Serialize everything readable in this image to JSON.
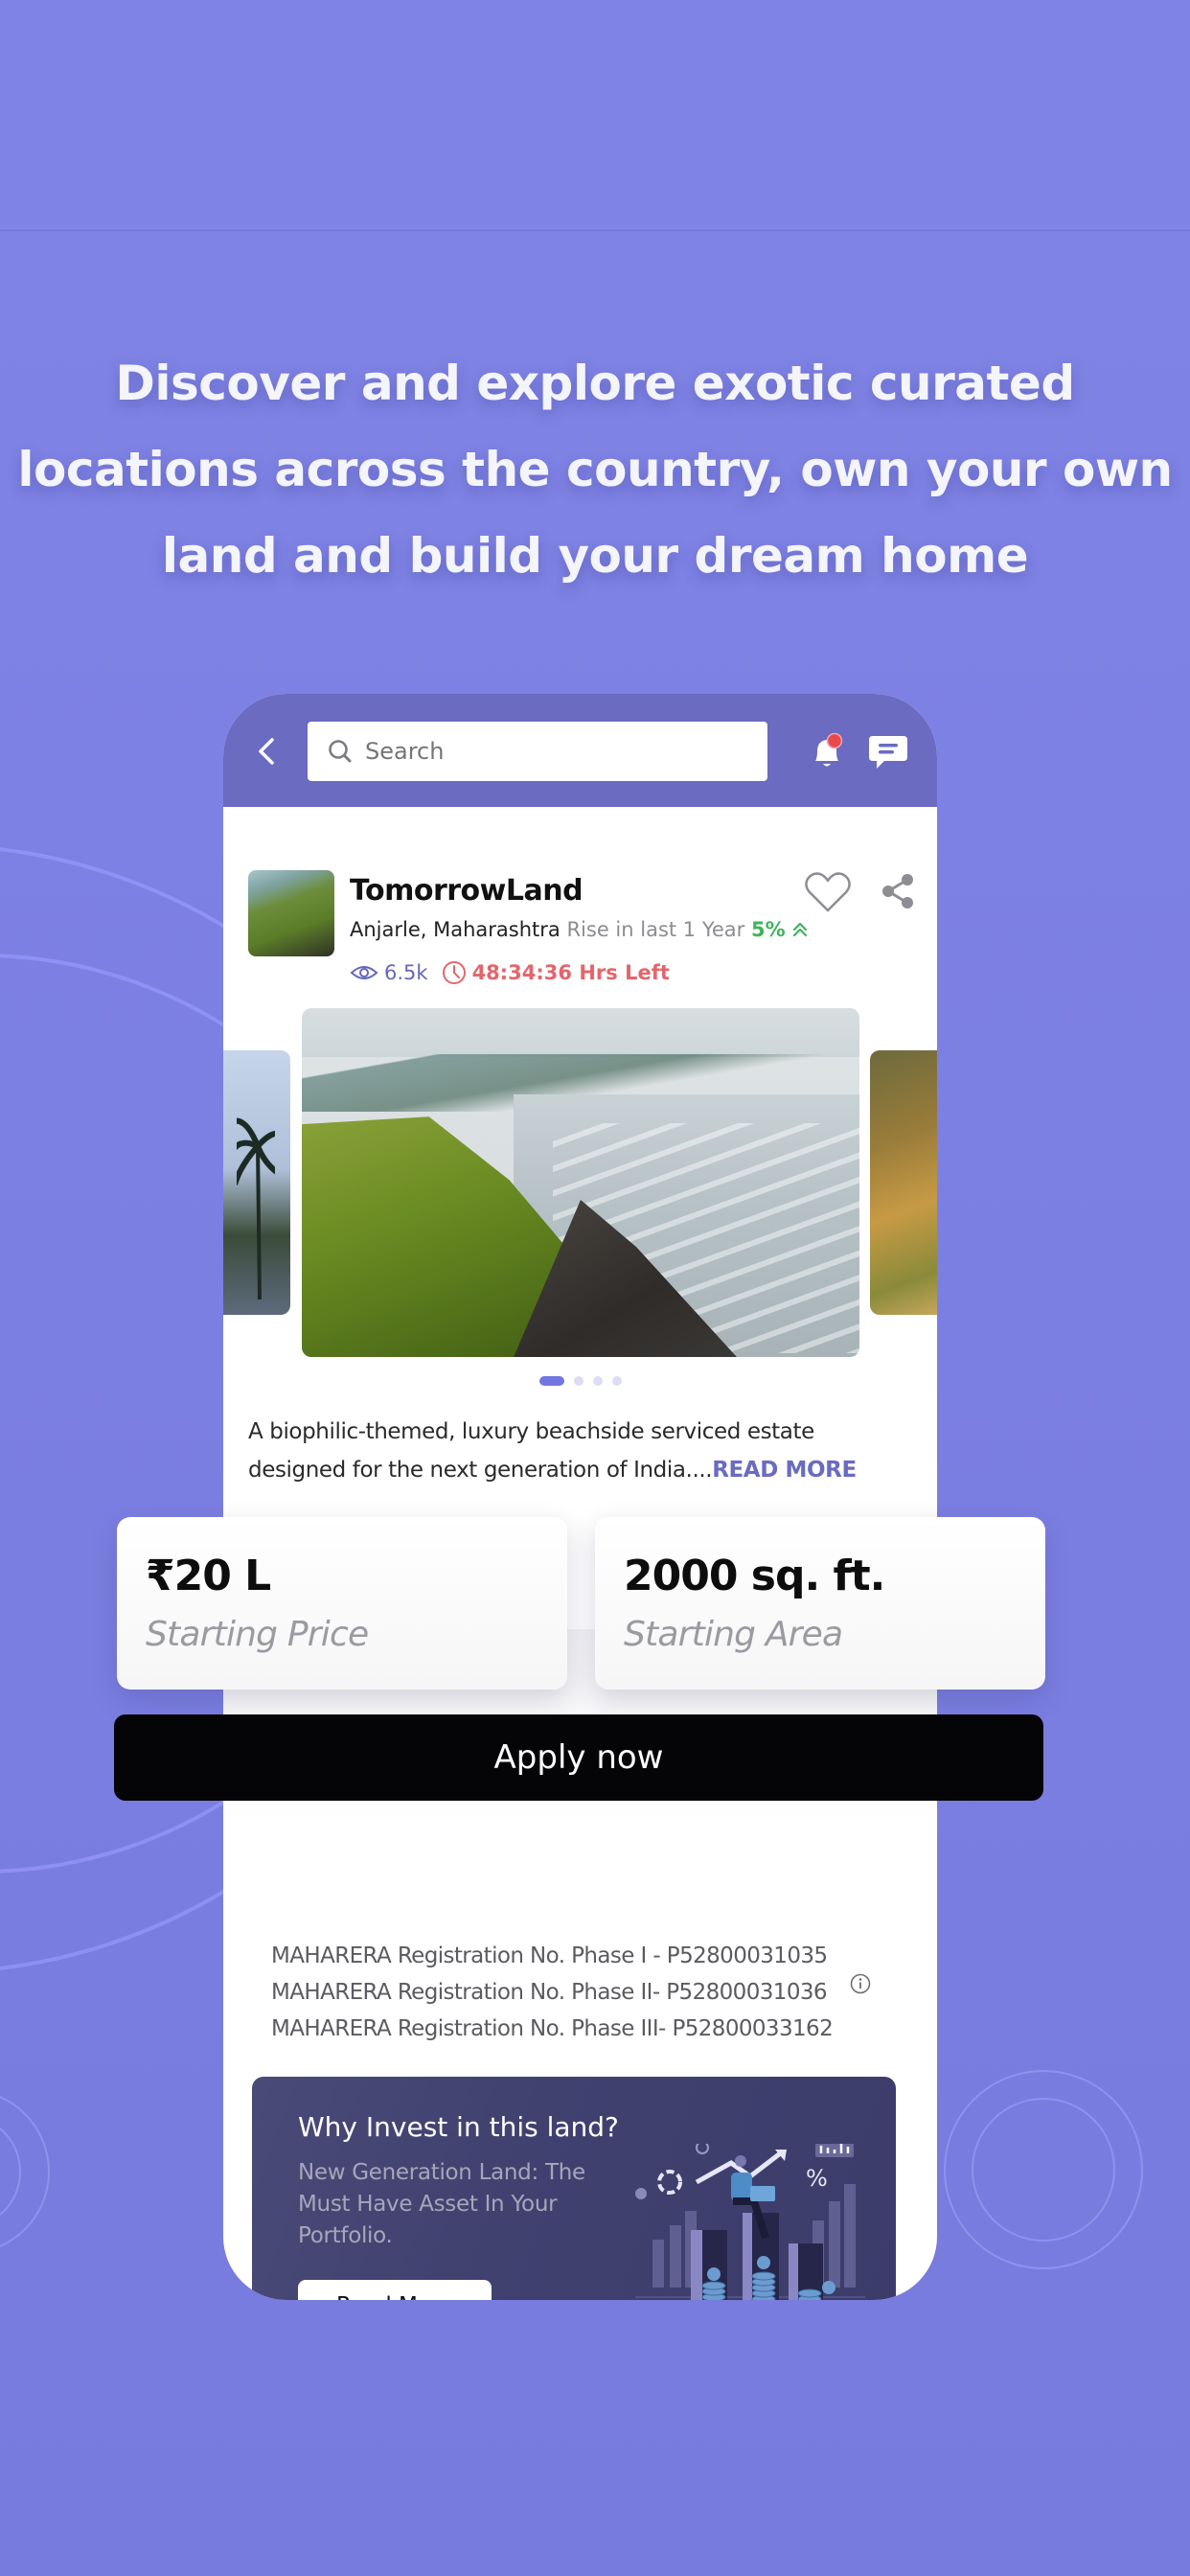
{
  "headline": {
    "lines": [
      "Discover and explore exotic curated",
      "locations across the country, own your own",
      "land and build your dream home"
    ]
  },
  "header": {
    "search_placeholder": "Search",
    "notification_badge": true
  },
  "listing": {
    "title": "TomorrowLand",
    "location": "Anjarle, Maharashtra",
    "rise_label": "Rise in last 1 Year",
    "rise_value": "5%",
    "views": "6.5k",
    "time_left": "48:34:36 Hrs Left",
    "description": "A biophilic-themed, luxury beachside serviced estate designed for the next generation of India....",
    "read_more": "READ MORE"
  },
  "carousel": {
    "slide_count": 4,
    "active_index": 0
  },
  "stats": [
    {
      "value": "₹20 L",
      "label": "Starting Price"
    },
    {
      "value": "2000 sq. ft.",
      "label": "Starting Area"
    }
  ],
  "apply_label": "Apply now",
  "registrations": [
    "MAHARERA Registration No. Phase I - P52800031035",
    "MAHARERA Registration No. Phase II- P52800031036",
    "MAHARERA Registration No. Phase III- P52800033162"
  ],
  "invest": {
    "title": "Why Invest in this land?",
    "subtitle": "New Generation Land: The Must Have Asset In Your Portfolio.",
    "button": "Read More"
  },
  "colors": {
    "background": "#7f84e4",
    "header": "#6a6bc1",
    "accent": "#6a6bc1",
    "positive": "#3fb45c",
    "timer": "#e2666c",
    "button_dark": "#050508",
    "invest_card": "#414170"
  }
}
